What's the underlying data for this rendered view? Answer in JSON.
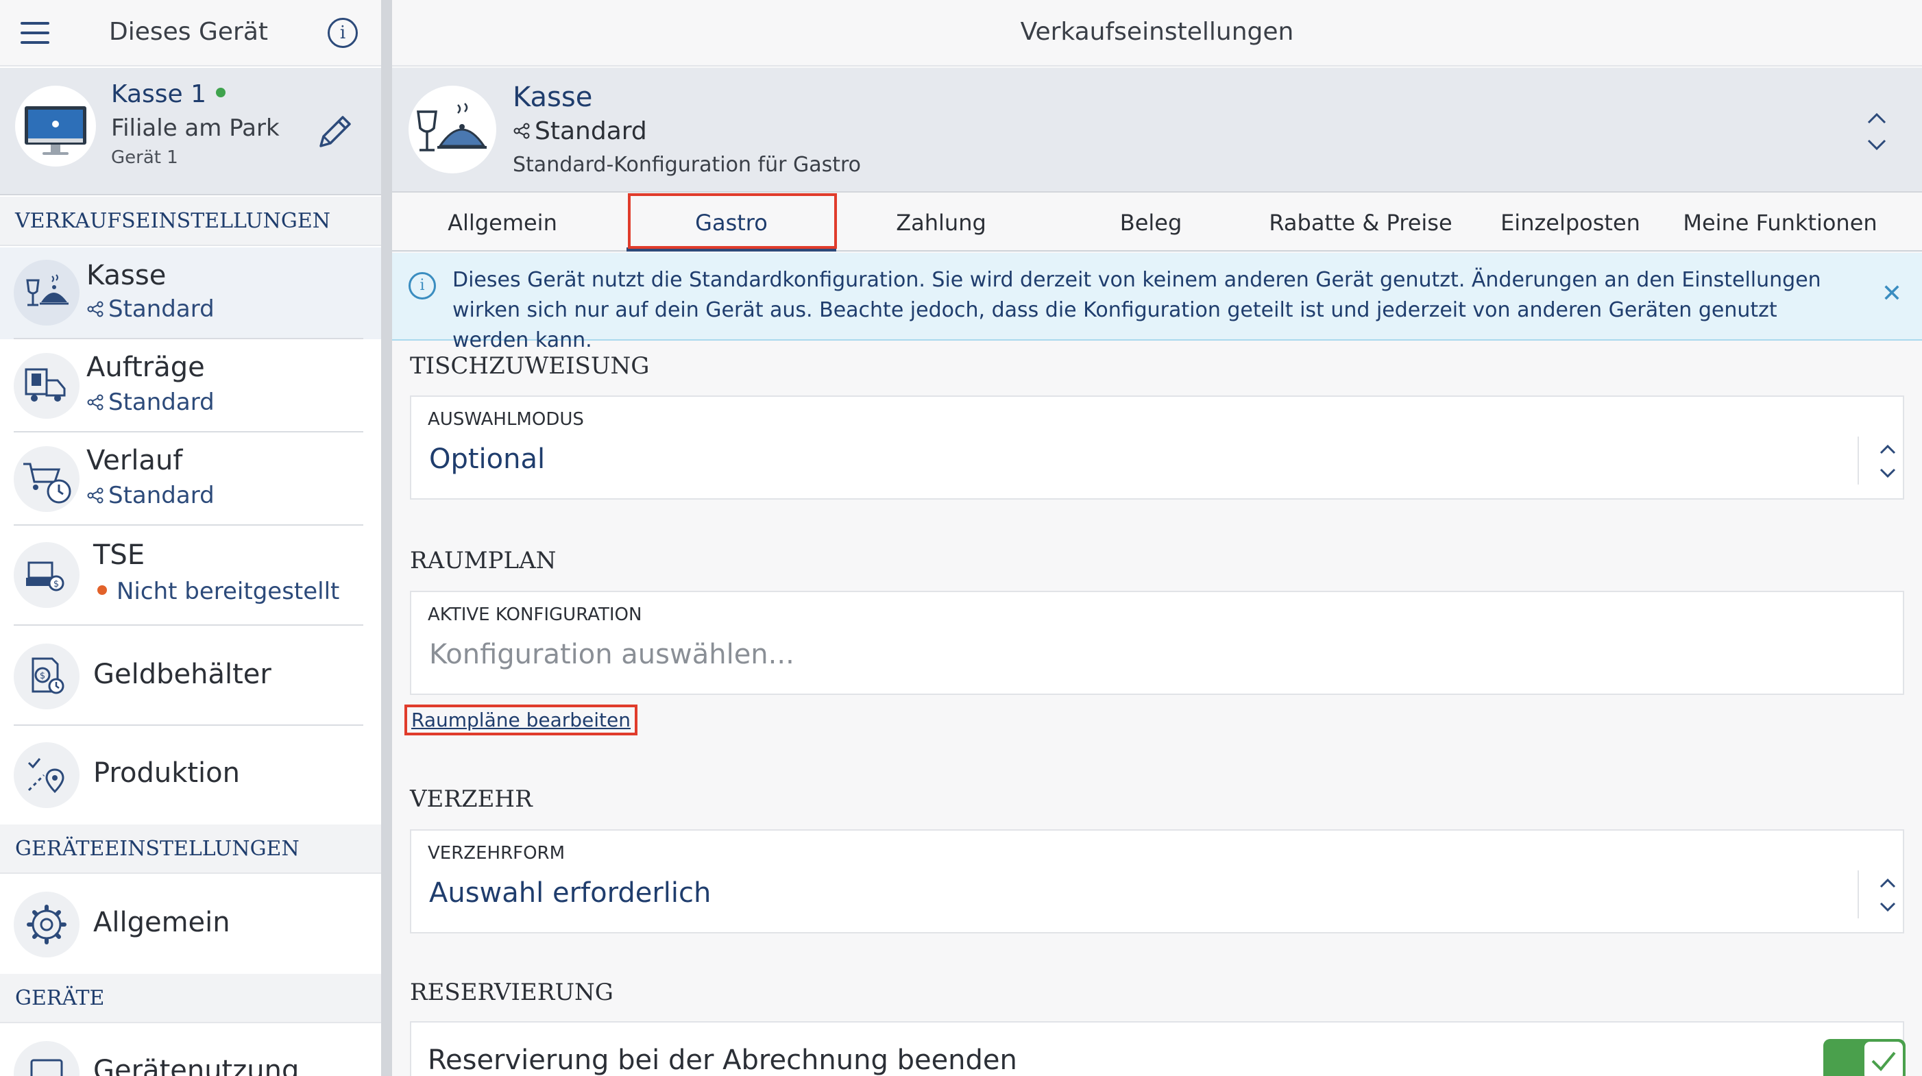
{
  "sidebar": {
    "title": "Dieses Gerät",
    "device": {
      "name": "Kasse 1",
      "location": "Filiale am Park",
      "number": "Gerät 1"
    },
    "sections": {
      "sales": "VERKAUFSEINSTELLUNGEN",
      "device_settings": "GERÄTEEINSTELLUNGEN",
      "devices": "GERÄTE"
    },
    "items": [
      {
        "title": "Kasse",
        "subtitle": "Standard"
      },
      {
        "title": "Aufträge",
        "subtitle": "Standard"
      },
      {
        "title": "Verlauf",
        "subtitle": "Standard"
      },
      {
        "title": "TSE",
        "subtitle": "Nicht bereitgestellt"
      },
      {
        "title": "Geldbehälter"
      },
      {
        "title": "Produktion"
      },
      {
        "title": "Allgemein"
      },
      {
        "title": "Gerätenutzung"
      }
    ]
  },
  "main": {
    "title": "Verkaufseinstellungen",
    "config": {
      "name": "Kasse",
      "profile": "Standard",
      "description": "Standard-Konfiguration für Gastro"
    },
    "tabs": [
      {
        "label": "Allgemein"
      },
      {
        "label": "Gastro"
      },
      {
        "label": "Zahlung"
      },
      {
        "label": "Beleg"
      },
      {
        "label": "Rabatte & Preise"
      },
      {
        "label": "Einzelposten"
      },
      {
        "label": "Meine Funktionen"
      }
    ],
    "active_tab": "Gastro",
    "notice": "Dieses Gerät nutzt die Standardkonfiguration. Sie wird derzeit von keinem anderen Gerät genutzt. Änderungen an den Einstellungen wirken sich nur auf dein Gerät aus. Beachte jedoch, dass die Konfiguration geteilt ist und jederzeit von anderen Geräten genutzt werden kann.",
    "groups": {
      "table": {
        "title": "TISCHZUWEISUNG",
        "field_label": "AUSWAHLMODUS",
        "field_value": "Optional"
      },
      "floorplan": {
        "title": "RAUMPLAN",
        "field_label": "AKTIVE KONFIGURATION",
        "field_placeholder": "Konfiguration auswählen...",
        "link": "Raumpläne bearbeiten"
      },
      "consumption": {
        "title": "VERZEHR",
        "field_label": "VERZEHRFORM",
        "field_value": "Auswahl erforderlich"
      },
      "reservation": {
        "title": "RESERVIERUNG",
        "toggle_label": "Reservierung bei der Abrechnung beenden",
        "toggle_on": true
      }
    }
  },
  "colors": {
    "accent": "#2c4a7a",
    "highlight": "#e03c2c",
    "online": "#3fa34d",
    "warning": "#e2622a",
    "toggle_on": "#4aa04c",
    "notice_bg": "#e4f3fa"
  }
}
